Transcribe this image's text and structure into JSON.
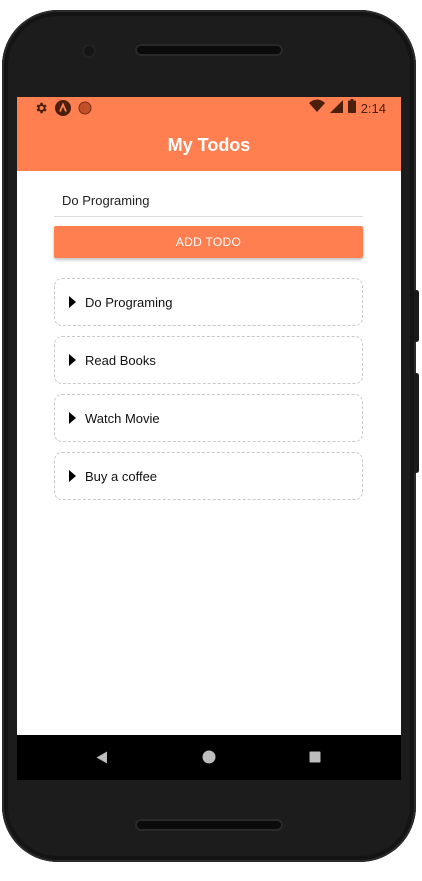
{
  "status_bar": {
    "time": "2:14",
    "left_icons": [
      "settings-icon",
      "app-logo-icon",
      "record-icon"
    ],
    "right_icons": [
      "wifi-icon",
      "signal-icon",
      "battery-icon"
    ],
    "color": "#ff7f50"
  },
  "app_bar": {
    "title": "My Todos",
    "color": "#ff7f50"
  },
  "form": {
    "input_value": "Do Programing",
    "add_button_label": "ADD TODO"
  },
  "todos": [
    {
      "label": "Do Programing"
    },
    {
      "label": "Read Books"
    },
    {
      "label": "Watch Movie"
    },
    {
      "label": "Buy a coffee"
    }
  ],
  "nav_bar": {
    "buttons": [
      "back-icon",
      "home-icon",
      "recents-icon"
    ]
  }
}
